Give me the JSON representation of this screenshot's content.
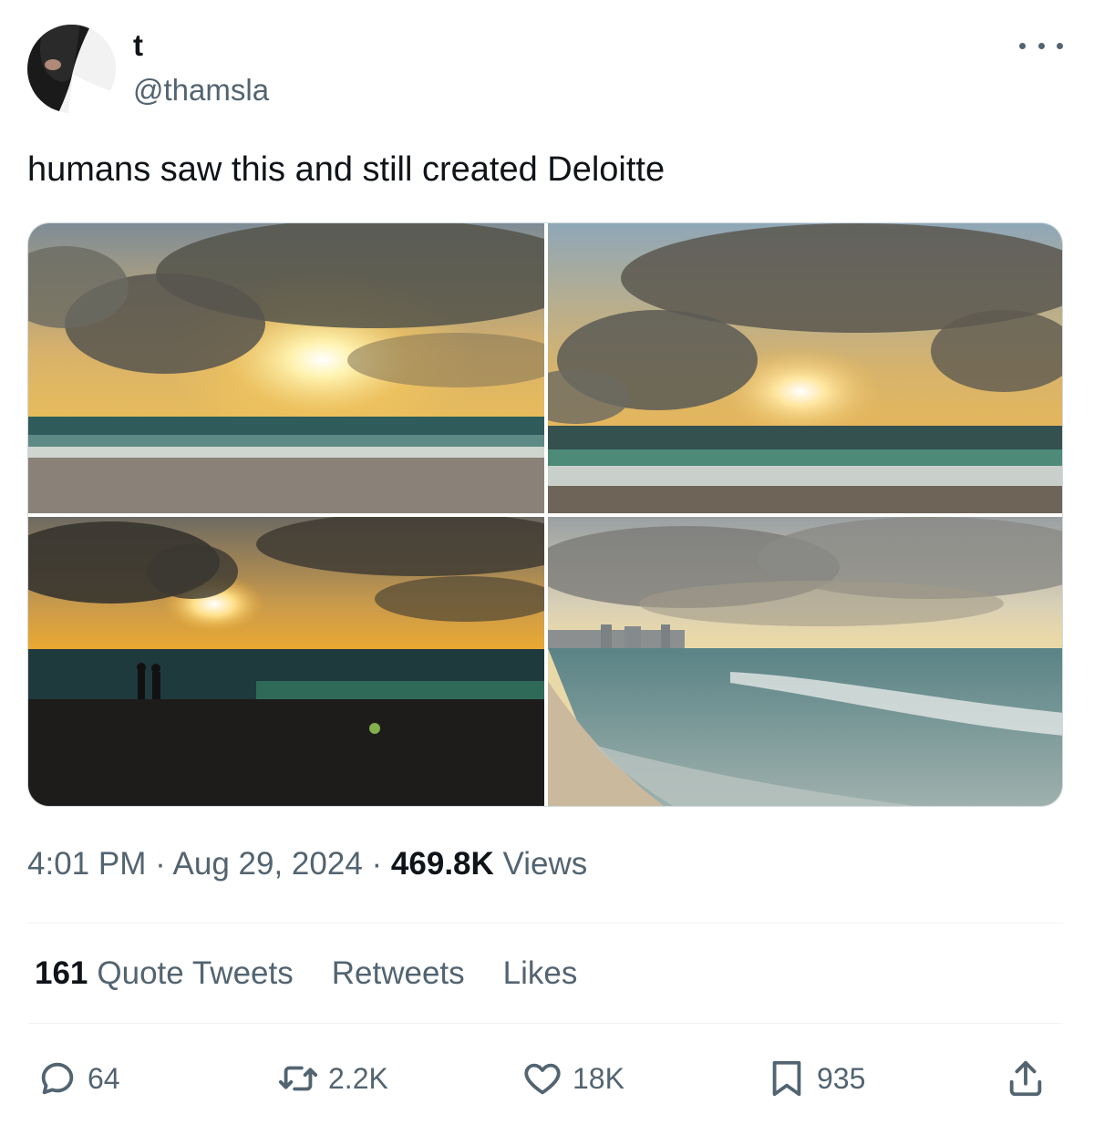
{
  "author": {
    "display_name": "t",
    "handle": "@thamsla"
  },
  "tweet": {
    "text": "humans saw this and still created Deloitte",
    "time": "4:01 PM",
    "date": "Aug 29, 2024",
    "separator": "·",
    "views_count": "469.8K",
    "views_label": "Views"
  },
  "stats": {
    "quote_tweets_count": "161",
    "quote_tweets_label": "Quote Tweets",
    "retweets_label": "Retweets",
    "likes_label": "Likes"
  },
  "actions": {
    "replies": "64",
    "retweets": "2.2K",
    "likes": "18K",
    "bookmarks": "935"
  },
  "icons": [
    "more-icon",
    "reply-icon",
    "retweet-icon",
    "like-icon",
    "bookmark-icon",
    "share-icon"
  ],
  "colors": {
    "text_primary": "#0f1419",
    "text_secondary": "#536471",
    "divider": "#eff3f4"
  }
}
